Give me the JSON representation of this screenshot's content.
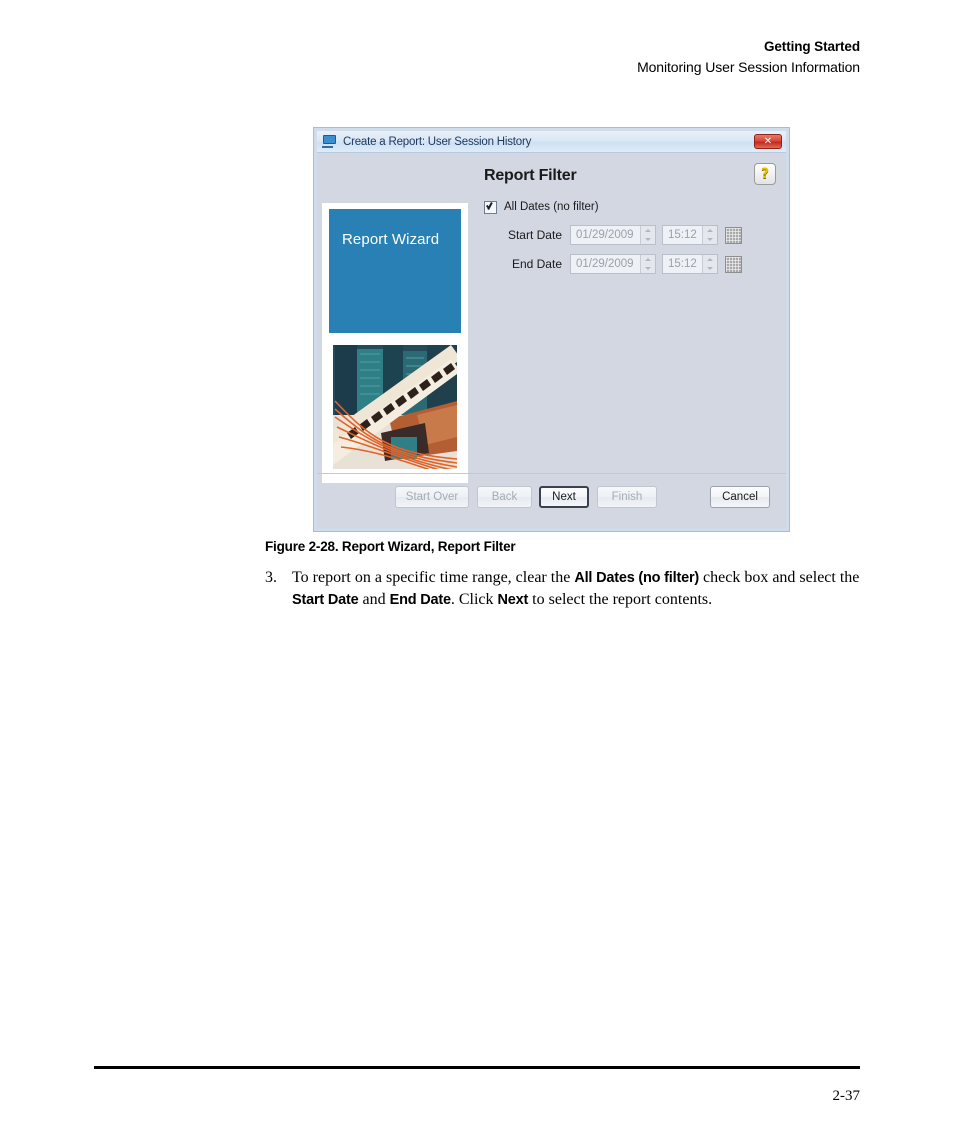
{
  "page_header": {
    "line1": "Getting Started",
    "line2": "Monitoring User Session Information"
  },
  "dialog": {
    "titlebar": {
      "icon": "monitor-icon",
      "title": "Create a Report: User Session History",
      "close_label": "✕"
    },
    "step_title": "Report Filter",
    "help_label": "?",
    "sidebar": {
      "banner_label": "Report Wizard",
      "banner_color": "#2980b4",
      "photo_alt": "architecture-photo"
    },
    "filter": {
      "all_dates_checkbox": {
        "label": "All Dates (no filter)",
        "checked": true
      },
      "rows": [
        {
          "label": "Start Date",
          "date_value": "01/29/2009",
          "time_value": "15:12",
          "calendar_icon": "calendar-icon",
          "disabled": true
        },
        {
          "label": "End Date",
          "date_value": "01/29/2009",
          "time_value": "15:12",
          "calendar_icon": "calendar-icon",
          "disabled": true
        }
      ]
    },
    "buttons": {
      "start_over": "Start Over",
      "back": "Back",
      "next": "Next",
      "finish": "Finish",
      "cancel": "Cancel"
    }
  },
  "figure_caption": "Figure 2-28. Report Wizard, Report Filter",
  "body_list_item": {
    "number": "3.",
    "segments": [
      {
        "text": "To report on a specific time range, clear the ",
        "bold": false
      },
      {
        "text": "All Dates (no filter)",
        "bold": true
      },
      {
        "text": " check box and select the ",
        "bold": false
      },
      {
        "text": "Start Date",
        "bold": true
      },
      {
        "text": " and ",
        "bold": false
      },
      {
        "text": "End Date",
        "bold": true
      },
      {
        "text": ". Click ",
        "bold": false
      },
      {
        "text": "Next",
        "bold": true
      },
      {
        "text": " to select the report contents.",
        "bold": false
      }
    ]
  },
  "footer": {
    "page_number": "2-37"
  }
}
